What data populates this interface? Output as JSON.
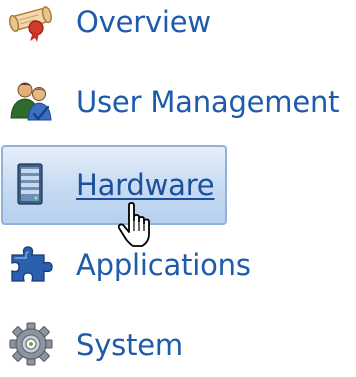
{
  "nav": {
    "items": [
      {
        "label": "Overview",
        "icon": "scroll-icon"
      },
      {
        "label": "User Management",
        "icon": "users-icon"
      },
      {
        "label": "Hardware",
        "icon": "server-icon"
      },
      {
        "label": "Applications",
        "icon": "puzzle-icon"
      },
      {
        "label": "System",
        "icon": "gear-icon"
      }
    ],
    "selected": "Hardware"
  },
  "colors": {
    "link": "#1e5bab",
    "highlight_border": "#8fb3dd",
    "highlight_fill": "#c8dcf2"
  }
}
